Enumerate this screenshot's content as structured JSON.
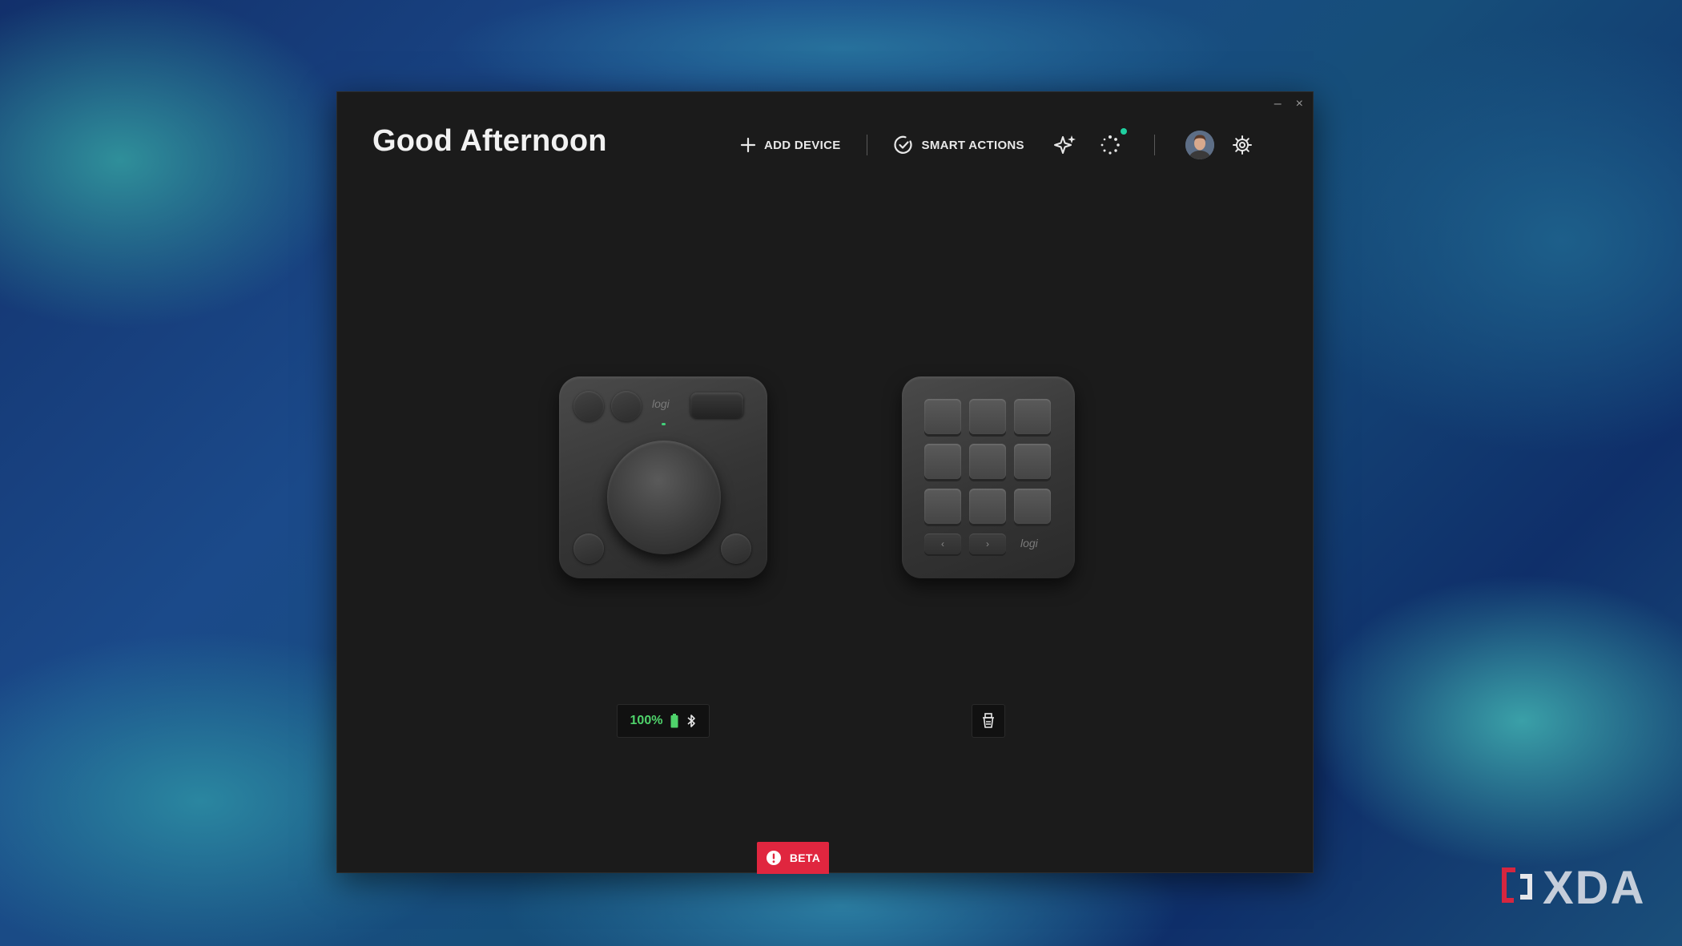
{
  "window": {
    "greeting": "Good Afternoon",
    "controls": {
      "minimize": "–",
      "close": "×"
    }
  },
  "toolbar": {
    "add_device_label": "ADD DEVICE",
    "smart_actions_label": "SMART ACTIONS",
    "icons": [
      "plus-icon",
      "smart-actions-check-icon",
      "sparkle-icon",
      "loading-spinner-icon",
      "avatar",
      "gear-icon"
    ],
    "notification_dot_color": "#1fd0a0"
  },
  "devices": [
    {
      "status": {
        "battery": "100%",
        "battery_color": "#4fd36b",
        "connection": "bluetooth-icon"
      },
      "logo": "logi"
    },
    {
      "status": {
        "connection": "usb-receiver-icon"
      },
      "logo": "logi"
    }
  ],
  "footer": {
    "beta_label": "BETA",
    "beta_color": "#e0263f"
  },
  "watermark": {
    "text": "XDA"
  }
}
